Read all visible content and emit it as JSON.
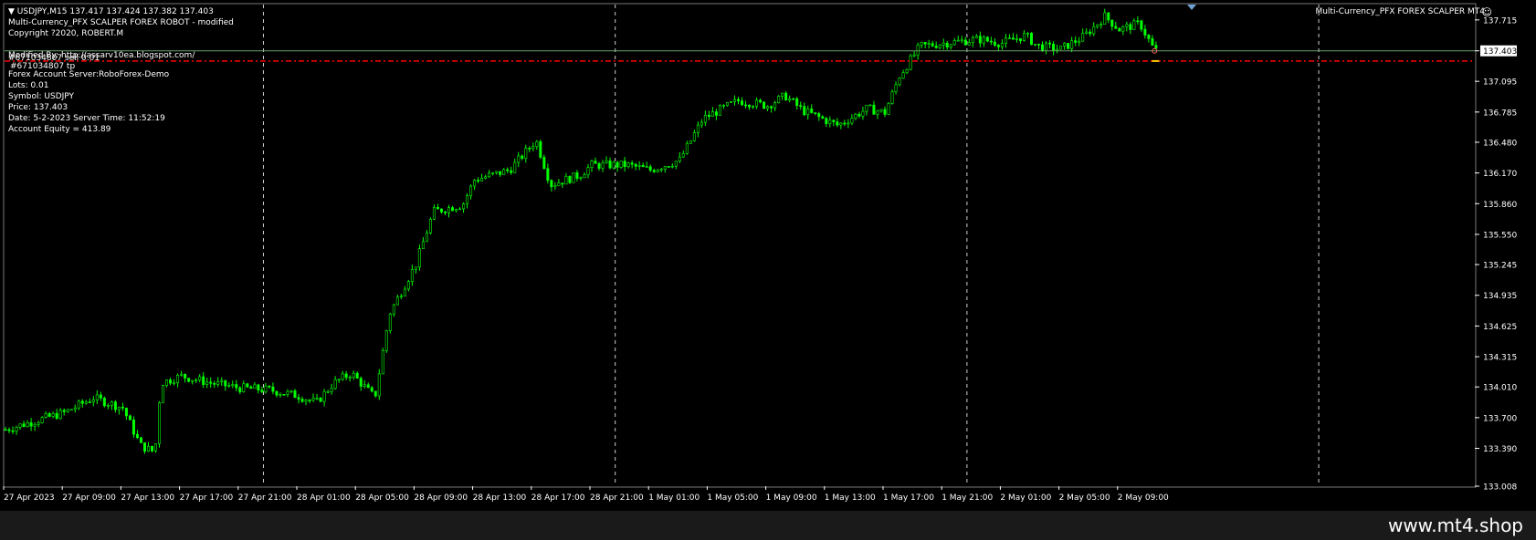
{
  "header": {
    "symbol_line": "USDJPY,M15  137.417 137.424 137.382 137.403",
    "ea_name": "Multi-Currency_PFX SCALPER FOREX ROBOT - modified",
    "copyright": "Copyright ?2020, ROBERT.M",
    "modified_by": "Modified By: http://assarv10ea.blogspot.com/",
    "order_line_1": "#671034807 sell 0.01",
    "order_line_2": "#671034807 tp",
    "server": "Forex Account Server:RoboForex-Demo",
    "lots": "Lots:  0.01",
    "symbol": "Symbol: USDJPY",
    "price": "Price:  137.403",
    "date": "Date: 5-2-2023 Server Time: 11:52:19",
    "equity": "Account Equity = 413.89"
  },
  "top_right": {
    "title": "Multi-Currency_PFX FOREX SCALPER MT4",
    "face_icon": "smiley-face-icon"
  },
  "watermark": "www.mt4.shop",
  "colors": {
    "background": "#000000",
    "candle": "#00ff00",
    "grid": "#ffffff",
    "bid_line": "#6aa36a",
    "tp_line": "#ff0000",
    "price_label_bg": "#ffffff"
  },
  "chart_data": {
    "type": "candlestick",
    "symbol": "USDJPY",
    "timeframe": "M15",
    "ylim": [
      133.008,
      137.87
    ],
    "y_ticks": [
      "137.715",
      "137.403",
      "137.095",
      "136.785",
      "136.480",
      "136.170",
      "135.860",
      "135.550",
      "135.245",
      "134.935",
      "134.625",
      "134.315",
      "134.010",
      "133.700",
      "133.390",
      "133.008"
    ],
    "y_tick_values": [
      137.715,
      137.403,
      137.095,
      136.785,
      136.48,
      136.17,
      135.86,
      135.55,
      135.245,
      134.935,
      134.625,
      134.315,
      134.01,
      133.7,
      133.39,
      133.008
    ],
    "current_price": 137.403,
    "tp_level": 137.3,
    "x_tick_labels": [
      "27 Apr 2023",
      "27 Apr 09:00",
      "27 Apr 13:00",
      "27 Apr 17:00",
      "27 Apr 21:00",
      "28 Apr 01:00",
      "28 Apr 05:00",
      "28 Apr 09:00",
      "28 Apr 13:00",
      "28 Apr 17:00",
      "28 Apr 21:00",
      "1 May 01:00",
      "1 May 05:00",
      "1 May 09:00",
      "1 May 13:00",
      "1 May 17:00",
      "1 May 21:00",
      "2 May 01:00",
      "2 May 05:00",
      "2 May 09:00"
    ],
    "close_path": [
      {
        "t": 0,
        "price": 133.58
      },
      {
        "t": 1,
        "price": 133.75
      },
      {
        "t": 1.5,
        "price": 133.9
      },
      {
        "t": 2,
        "price": 133.8
      },
      {
        "t": 2.3,
        "price": 133.42
      },
      {
        "t": 2.55,
        "price": 133.35
      },
      {
        "t": 2.65,
        "price": 134.05
      },
      {
        "t": 3,
        "price": 134.12
      },
      {
        "t": 3.5,
        "price": 134.05
      },
      {
        "t": 4,
        "price": 134.0
      },
      {
        "t": 4.5,
        "price": 133.98
      },
      {
        "t": 5,
        "price": 133.92
      },
      {
        "t": 5.3,
        "price": 133.85
      },
      {
        "t": 5.6,
        "price": 134.05
      },
      {
        "t": 5.9,
        "price": 134.15
      },
      {
        "t": 6.3,
        "price": 133.9
      },
      {
        "t": 6.55,
        "price": 134.75
      },
      {
        "t": 7,
        "price": 135.25
      },
      {
        "t": 7.3,
        "price": 135.78
      },
      {
        "t": 7.8,
        "price": 135.85
      },
      {
        "t": 8,
        "price": 136.1
      },
      {
        "t": 8.6,
        "price": 136.2
      },
      {
        "t": 9.05,
        "price": 136.5
      },
      {
        "t": 9.3,
        "price": 136.05
      },
      {
        "t": 9.8,
        "price": 136.15
      },
      {
        "t": 10,
        "price": 136.25
      },
      {
        "t": 10.6,
        "price": 136.25
      },
      {
        "t": 11,
        "price": 136.2
      },
      {
        "t": 11.5,
        "price": 136.3
      },
      {
        "t": 11.9,
        "price": 136.72
      },
      {
        "t": 12.5,
        "price": 136.9
      },
      {
        "t": 13,
        "price": 136.85
      },
      {
        "t": 13.3,
        "price": 136.95
      },
      {
        "t": 13.6,
        "price": 136.8
      },
      {
        "t": 14,
        "price": 136.7
      },
      {
        "t": 14.2,
        "price": 136.65
      },
      {
        "t": 14.7,
        "price": 136.82
      },
      {
        "t": 15,
        "price": 136.78
      },
      {
        "t": 15.25,
        "price": 137.15
      },
      {
        "t": 15.6,
        "price": 137.45
      },
      {
        "t": 16,
        "price": 137.48
      },
      {
        "t": 16.6,
        "price": 137.52
      },
      {
        "t": 17,
        "price": 137.48
      },
      {
        "t": 17.4,
        "price": 137.56
      },
      {
        "t": 17.6,
        "price": 137.45
      },
      {
        "t": 18,
        "price": 137.42
      },
      {
        "t": 18.4,
        "price": 137.55
      },
      {
        "t": 18.75,
        "price": 137.75
      },
      {
        "t": 19,
        "price": 137.62
      },
      {
        "t": 19.35,
        "price": 137.68
      },
      {
        "t": 19.6,
        "price": 137.403
      }
    ]
  }
}
